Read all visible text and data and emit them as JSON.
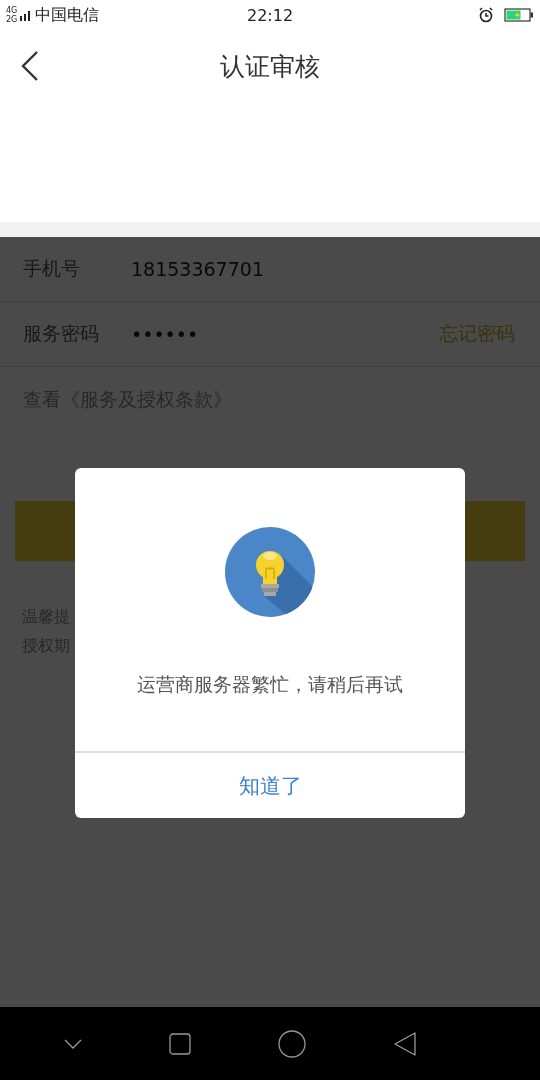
{
  "status_bar": {
    "network": [
      "4G",
      "2G"
    ],
    "carrier": "中国电信",
    "time": "22:12"
  },
  "header": {
    "title": "认证审核"
  },
  "form": {
    "rows": [
      {
        "label": "手机号",
        "value": "18153367701"
      },
      {
        "label": "服务密码",
        "value": "••••••",
        "action": "忘记密码"
      }
    ],
    "terms": "查看《服务及授权条款》",
    "tips": [
      "温馨提",
      "授权期"
    ]
  },
  "dialog": {
    "message": "运营商服务器繁忙，请稍后再试",
    "button": "知道了"
  }
}
